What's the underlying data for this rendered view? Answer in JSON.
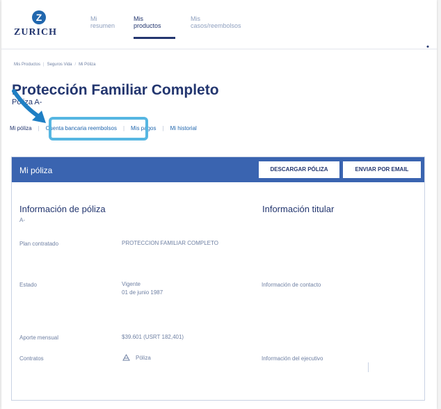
{
  "logo": {
    "mark": "Z",
    "text": "ZURICH"
  },
  "nav": [
    {
      "label": "Mi\nresumen"
    },
    {
      "label": "Mis\nproductos"
    },
    {
      "label": "Mis\ncasos/reembolsos"
    }
  ],
  "breadcrumb": [
    "Mis Productos",
    "Seguros Vida",
    "Mi Póliza"
  ],
  "title": "Protección Familiar Completo",
  "policy_subtitle": "Póliza A-",
  "tabs": [
    "Mi póliza",
    "Cuenta bancaria reembolsos",
    "Mis pagos",
    "Mi historial"
  ],
  "card": {
    "header_title": "Mi póliza",
    "download_button": "DESCARGAR PÓLIZA",
    "email_button": "ENVIAR POR EMAIL"
  },
  "policy_info": {
    "title": "Información de póliza",
    "number": "A-",
    "plan_label": "Plan contratado",
    "plan_value": "PROTECCION FAMILIAR COMPLETO",
    "status_label": "Estado",
    "status_value": "Vigente",
    "status_date": "01 de junio 1987",
    "monthly_label": "Aporte mensual",
    "monthly_value": "$39.601 (USRT 182,401)",
    "contracts_label": "Contratos",
    "contracts_value": "Póliza"
  },
  "holder_info": {
    "title": "Información titular",
    "contact_label": "Información de contacto",
    "executive_label": "Información del ejecutivo"
  },
  "colors": {
    "brand_navy": "#23366f",
    "card_header": "#3a64b0",
    "highlight": "#56b6e2",
    "link": "#2167ae"
  },
  "icons": [
    "zurich-logo-icon",
    "menu-dots-icon",
    "arrow-annotation-icon",
    "document-product-icon"
  ]
}
